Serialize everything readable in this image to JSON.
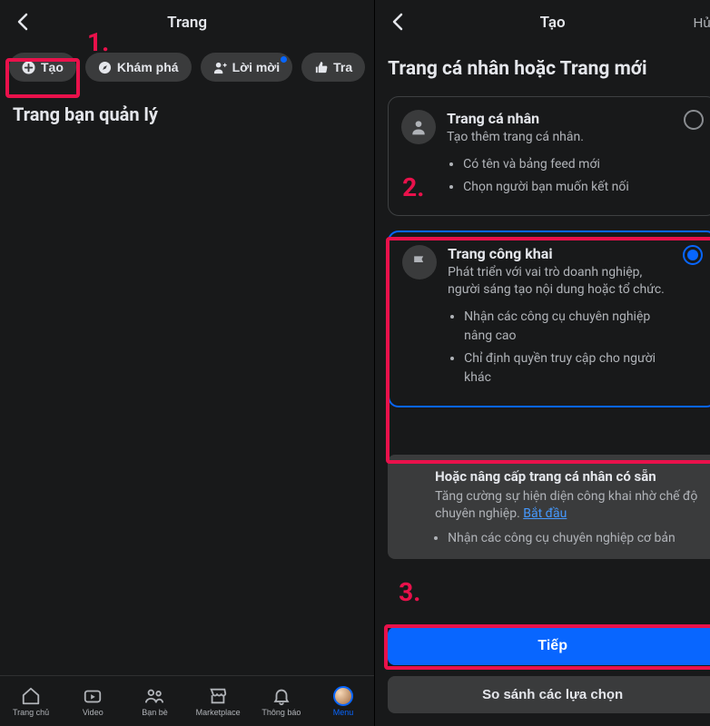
{
  "colors": {
    "accent": "#0866ff",
    "annot": "#e9114b"
  },
  "annotations": {
    "n1": "1.",
    "n2": "2.",
    "n3": "3."
  },
  "left": {
    "title": "Trang",
    "section_title": "Trang bạn quản lý",
    "chips": [
      {
        "icon": "plus-icon",
        "label": "Tạo"
      },
      {
        "icon": "compass-icon",
        "label": "Khám phá"
      },
      {
        "icon": "friend-request-icon",
        "label": "Lời mời",
        "dot": true
      },
      {
        "icon": "like-icon",
        "label": "Tra"
      }
    ],
    "nav": [
      {
        "icon": "home-icon",
        "label": "Trang chủ"
      },
      {
        "icon": "video-icon",
        "label": "Video"
      },
      {
        "icon": "friends-icon",
        "label": "Bạn bè"
      },
      {
        "icon": "marketplace-icon",
        "label": "Marketplace"
      },
      {
        "icon": "bell-icon",
        "label": "Thông báo"
      },
      {
        "icon": "menu-avatar-icon",
        "label": "Menu",
        "active": true
      }
    ]
  },
  "right": {
    "title": "Tạo",
    "cancel": "Hủy",
    "heading": "Trang cá nhân hoặc Trang mới",
    "options": [
      {
        "key": "profile",
        "title": "Trang cá nhân",
        "subtitle": "Tạo thêm trang cá nhân.",
        "bullets": [
          "Có tên và bảng feed mới",
          "Chọn người bạn muốn kết nối"
        ],
        "selected": false
      },
      {
        "key": "public-page",
        "title": "Trang công khai",
        "subtitle": "Phát triển với vai trò doanh nghiệp, người sáng tạo nội dung hoặc tổ chức.",
        "bullets": [
          "Nhận các công cụ chuyên nghiệp nâng cao",
          "Chỉ định quyền truy cập cho người khác"
        ],
        "selected": true
      }
    ],
    "upgrade": {
      "title": "Hoặc nâng cấp trang cá nhân có sẵn",
      "subtitle_pre": "Tăng cường sự hiện diện công khai nhờ chế độ chuyên nghiệp. ",
      "link": "Bắt đầu",
      "bullets": [
        "Nhận các công cụ chuyên nghiệp cơ bản"
      ]
    },
    "next_btn": "Tiếp",
    "compare_btn": "So sánh các lựa chọn"
  }
}
